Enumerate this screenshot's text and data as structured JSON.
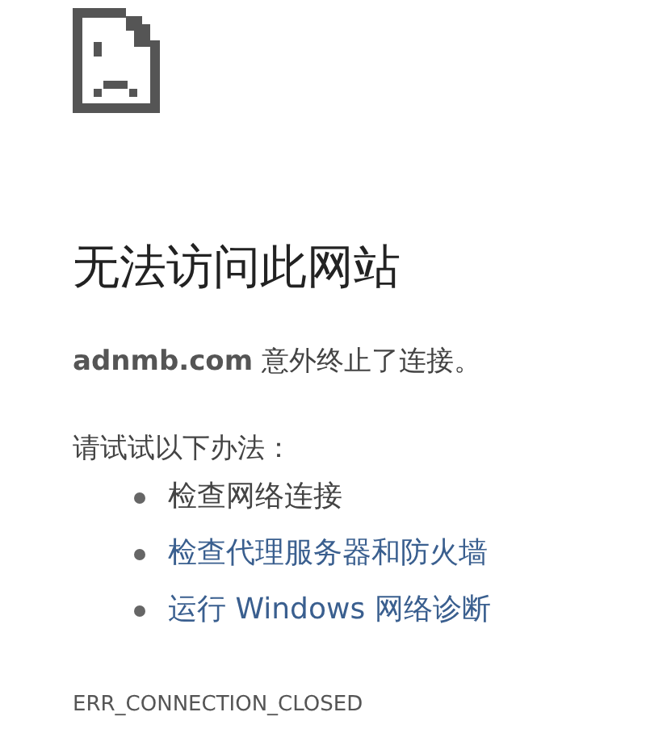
{
  "heading": "无法访问此网站",
  "message": {
    "domain": "adnmb.com",
    "text": "意外终止了连接。"
  },
  "suggestions": {
    "title": "请试试以下办法：",
    "items": [
      {
        "kind": "text",
        "label": "检查网络连接"
      },
      {
        "kind": "link",
        "label": "检查代理服务器和防火墙"
      },
      {
        "kind": "link",
        "label": "运行 Windows 网络诊断"
      }
    ]
  },
  "error_code": "ERR_CONNECTION_CLOSED"
}
